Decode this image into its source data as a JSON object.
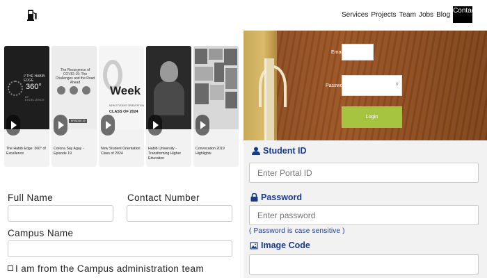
{
  "header": {
    "icon": "fuel-pump-icon",
    "nav": [
      "Services",
      "Projects",
      "Team",
      "Jobs",
      "Blog"
    ],
    "active_nav": "Contact"
  },
  "videos": [
    {
      "title": "The Habib Edge: 360° of Excellence",
      "thumb_line1": "// THE HABIB EDGE",
      "thumb_line2": "360°",
      "thumb_line3": "OF EXCELLENCE"
    },
    {
      "title": "Corona Say Agay - Episode 19",
      "thumb_heading": "The Resurgence of COVID-19: The Challenges and the Road Ahead",
      "thumb_episode": "EPISODE 19"
    },
    {
      "title": "New Student Orientation Class of 2024",
      "thumb_word": "Week",
      "thumb_small": "NEW STUDENT ORIENTATION",
      "thumb_class": "CLASS OF 2024"
    },
    {
      "title": "Habib University - Transforming Higher Education"
    },
    {
      "title": "Convocation 2019 Highlights"
    }
  ],
  "form": {
    "full_name_label": "Full Name",
    "contact_label": "Contact Number",
    "campus_label": "Campus Name",
    "checkbox_label": "I am from the Campus administration team"
  },
  "login_panel": {
    "email_label": "Email",
    "password_label": "Password",
    "login_label": "Login",
    "accent_color": "#a7c441"
  },
  "portal": {
    "student_id_label": "Student ID",
    "student_id_placeholder": "Enter Portal ID",
    "password_label": "Password",
    "password_placeholder": "Enter password",
    "password_hint": "( Password is case sensitive )",
    "image_code_label": "Image Code",
    "label_color": "#1a3a8c"
  }
}
